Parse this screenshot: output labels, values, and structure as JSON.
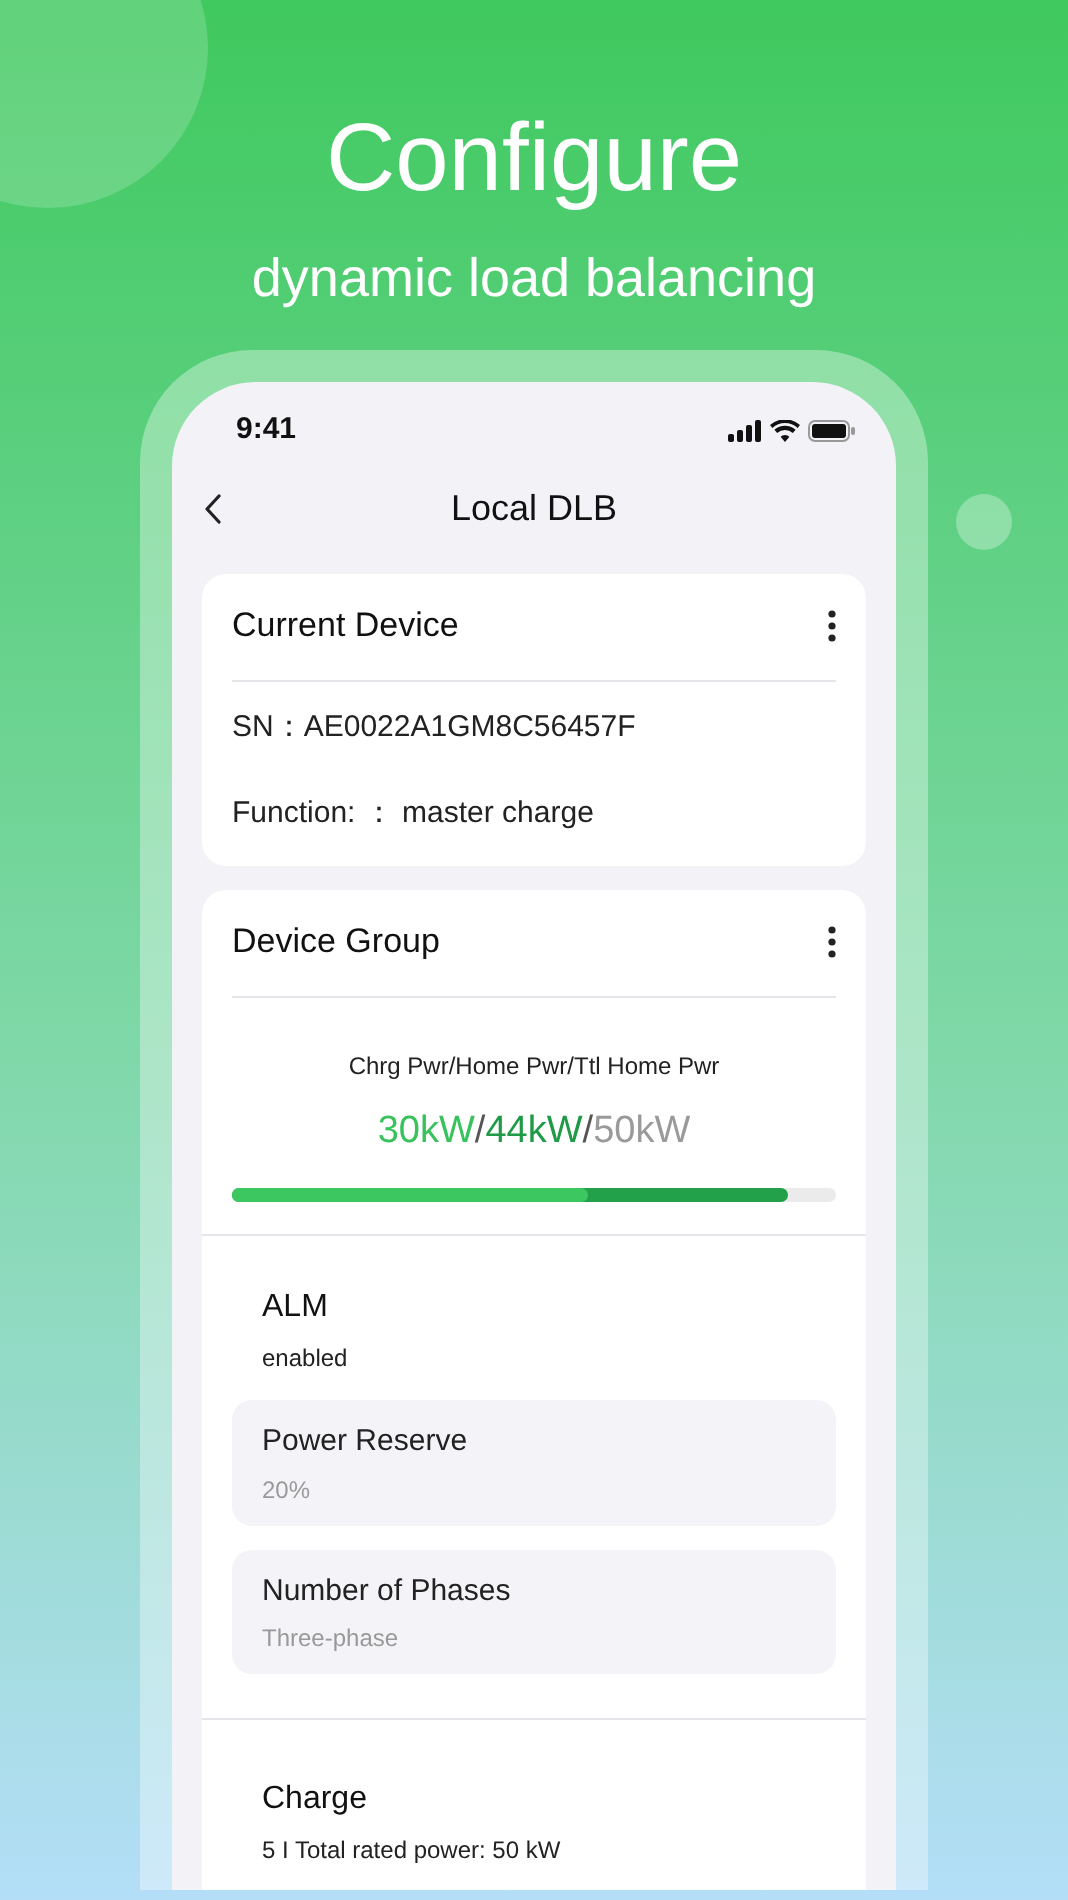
{
  "headline": "Configure",
  "subheadline": "dynamic load balancing",
  "status_bar": {
    "time": "9:41"
  },
  "nav": {
    "title": "Local DLB"
  },
  "current_device": {
    "title": "Current Device",
    "fields": [
      "SN：AE0022A1GM8C56457F",
      "Function: ： master charge"
    ]
  },
  "device_group": {
    "title": "Device Group",
    "power_caption": "Chrg Pwr/Home Pwr/Ttl Home Pwr",
    "readings": [
      {
        "text": "30kW",
        "color": "#37c25b"
      },
      {
        "text": "/",
        "color": "#555555"
      },
      {
        "text": "44kW",
        "color": "#1f9a46"
      },
      {
        "text": "/",
        "color": "#555555"
      },
      {
        "text": "50kW",
        "color": "#9a9a9a"
      }
    ],
    "power_bar": [
      {
        "level": 0.59,
        "color": "#3cc760"
      },
      {
        "level": 0.92,
        "color": "#22a04a"
      }
    ],
    "sections": [
      {
        "title": "ALM",
        "subtitle": "enabled",
        "items": [
          {
            "label": "Power Reserve",
            "value": "20%"
          },
          {
            "label": "Number of Phases",
            "value": "Three-phase"
          }
        ]
      },
      {
        "title": "Charge",
        "subtitle": "5 I Total rated power: 50 kW"
      }
    ]
  }
}
